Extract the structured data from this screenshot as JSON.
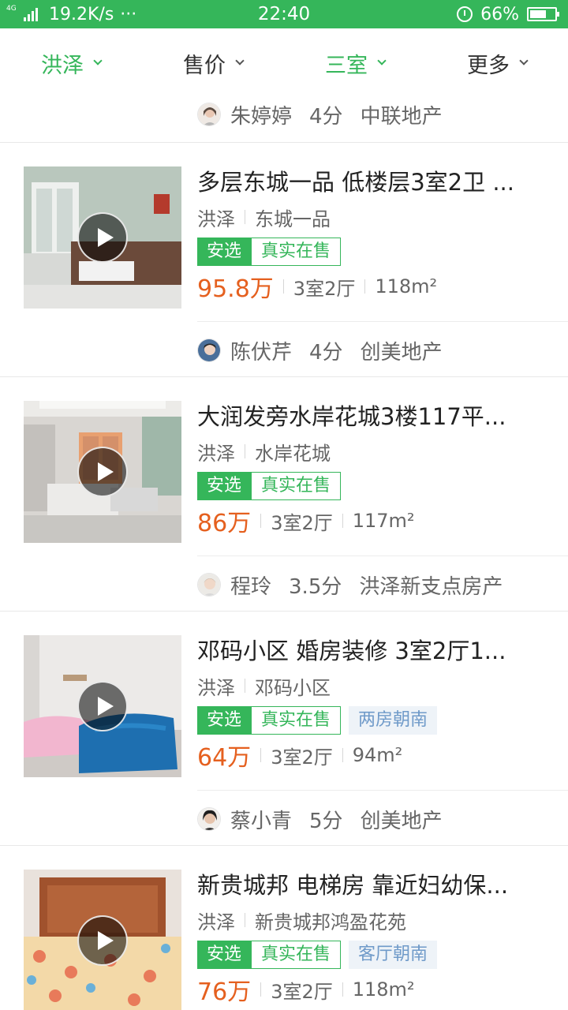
{
  "status_bar": {
    "network": "4G",
    "speed": "19.2K/s",
    "dots": "···",
    "time": "22:40",
    "battery": "66%",
    "battery_level": 0.66
  },
  "filters": [
    {
      "label": "洪泽",
      "active": true
    },
    {
      "label": "售价",
      "active": false
    },
    {
      "label": "三室",
      "active": true
    },
    {
      "label": "更多",
      "active": false
    }
  ],
  "top_agent": {
    "name": "朱婷婷",
    "score": "4分",
    "company": "中联地产"
  },
  "listings": [
    {
      "title": "多层东城一品 低楼层3室2卫 ...",
      "district": "洪泽",
      "community": "东城一品",
      "tag_an": "安选",
      "tag_real": "真实在售",
      "feature": "",
      "price": "95.8万",
      "layout": "3室2厅",
      "area": "118m²",
      "agent": {
        "name": "陈伏芹",
        "score": "4分",
        "company": "创美地产"
      }
    },
    {
      "title": "大润发旁水岸花城3楼117平...",
      "district": "洪泽",
      "community": "水岸花城",
      "tag_an": "安选",
      "tag_real": "真实在售",
      "feature": "",
      "price": "86万",
      "layout": "3室2厅",
      "area": "117m²",
      "agent": {
        "name": "程玲",
        "score": "3.5分",
        "company": "洪泽新支点房产"
      }
    },
    {
      "title": "邓码小区 婚房装修 3室2厅1...",
      "district": "洪泽",
      "community": "邓码小区",
      "tag_an": "安选",
      "tag_real": "真实在售",
      "feature": "两房朝南",
      "price": "64万",
      "layout": "3室2厅",
      "area": "94m²",
      "agent": {
        "name": "蔡小青",
        "score": "5分",
        "company": "创美地产"
      }
    },
    {
      "title": "新贵城邦 电梯房 靠近妇幼保...",
      "district": "洪泽",
      "community": "新贵城邦鸿盈花苑",
      "tag_an": "安选",
      "tag_real": "真实在售",
      "feature": "客厅朝南",
      "price": "76万",
      "layout": "3室2厅",
      "area": "118m²",
      "agent": {
        "name": "",
        "score": "",
        "company": ""
      }
    }
  ],
  "colors": {
    "accent": "#35b65a",
    "price": "#e5601f",
    "feature": "#6f9ac9"
  }
}
